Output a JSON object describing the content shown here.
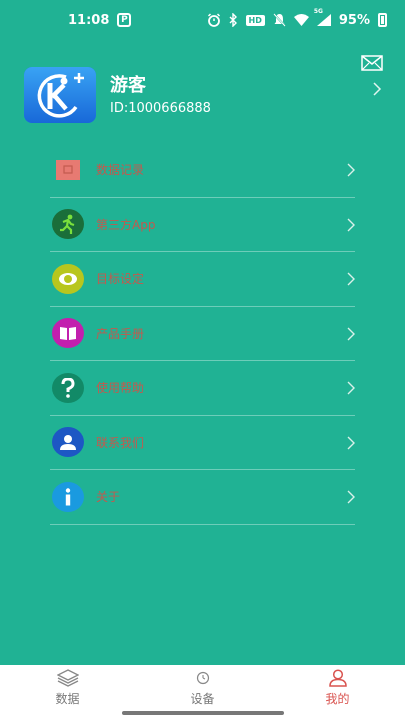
{
  "status_bar": {
    "time": "11:08",
    "p_label": "P",
    "hd_label": "HD",
    "network_label": "5G",
    "battery": "95%"
  },
  "profile": {
    "name": "游客",
    "id_text": "ID:1000666888"
  },
  "menu": {
    "items": [
      {
        "label": "数据记录",
        "icon": "calendar-icon"
      },
      {
        "label": "第三方App",
        "icon": "runner-icon"
      },
      {
        "label": "目标设定",
        "icon": "target-icon"
      },
      {
        "label": "产品手册",
        "icon": "book-icon"
      },
      {
        "label": "使用帮助",
        "icon": "question-icon"
      },
      {
        "label": "联系我们",
        "icon": "person-icon"
      },
      {
        "label": "关于",
        "icon": "info-icon"
      }
    ]
  },
  "bottom_nav": {
    "data": "数据",
    "device": "设备",
    "mine": "我的"
  },
  "colors": {
    "background": "#20b294",
    "label_text": "#c25a4e",
    "active_tab": "#d9534f"
  }
}
